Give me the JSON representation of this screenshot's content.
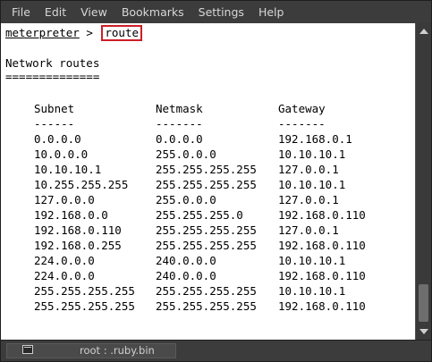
{
  "menu": {
    "items": [
      "File",
      "Edit",
      "View",
      "Bookmarks",
      "Settings",
      "Help"
    ]
  },
  "terminal": {
    "prompt": "meterpreter",
    "separator": " > ",
    "command": "route",
    "heading": "Network routes",
    "underline": "==============",
    "columns": {
      "subnet": "Subnet",
      "netmask": "Netmask",
      "gateway": "Gateway"
    },
    "dashes": {
      "subnet": "------",
      "netmask": "-------",
      "gateway": "-------"
    },
    "rows": [
      {
        "subnet": "0.0.0.0",
        "netmask": "0.0.0.0",
        "gateway": "192.168.0.1"
      },
      {
        "subnet": "10.0.0.0",
        "netmask": "255.0.0.0",
        "gateway": "10.10.10.1"
      },
      {
        "subnet": "10.10.10.1",
        "netmask": "255.255.255.255",
        "gateway": "127.0.0.1"
      },
      {
        "subnet": "10.255.255.255",
        "netmask": "255.255.255.255",
        "gateway": "10.10.10.1"
      },
      {
        "subnet": "127.0.0.0",
        "netmask": "255.0.0.0",
        "gateway": "127.0.0.1"
      },
      {
        "subnet": "192.168.0.0",
        "netmask": "255.255.255.0",
        "gateway": "192.168.0.110"
      },
      {
        "subnet": "192.168.0.110",
        "netmask": "255.255.255.255",
        "gateway": "127.0.0.1"
      },
      {
        "subnet": "192.168.0.255",
        "netmask": "255.255.255.255",
        "gateway": "192.168.0.110"
      },
      {
        "subnet": "224.0.0.0",
        "netmask": "240.0.0.0",
        "gateway": "10.10.10.1"
      },
      {
        "subnet": "224.0.0.0",
        "netmask": "240.0.0.0",
        "gateway": "192.168.0.110"
      },
      {
        "subnet": "255.255.255.255",
        "netmask": "255.255.255.255",
        "gateway": "10.10.10.1"
      },
      {
        "subnet": "255.255.255.255",
        "netmask": "255.255.255.255",
        "gateway": "192.168.0.110"
      }
    ]
  },
  "statusbar": {
    "tab_label": "root : .ruby.bin",
    "tab_icon": "terminal-icon"
  },
  "colors": {
    "highlight": "#cc1f27",
    "menubar": "#3c3c3c",
    "terminal_bg": "#ffffff"
  }
}
